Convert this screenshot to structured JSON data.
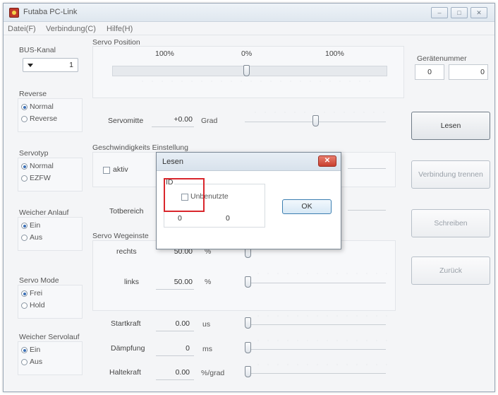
{
  "window": {
    "title": "Futaba PC-Link",
    "controls": [
      "–",
      "□",
      "✕"
    ]
  },
  "menu": {
    "file": "Datei(F)",
    "connection": "Verbindung(C)",
    "help": "Hilfe(H)"
  },
  "bus": {
    "label": "BUS-Kanal",
    "value": "1"
  },
  "reverse": {
    "label": "Reverse",
    "options": [
      "Normal",
      "Reverse"
    ],
    "selected": "Normal"
  },
  "servotype": {
    "label": "Servotyp",
    "options": [
      "Normal",
      "EZFW"
    ],
    "selected": "Normal"
  },
  "soft_start": {
    "label": "Weicher Anlauf",
    "options": [
      "Ein",
      "Aus"
    ],
    "selected": "Ein"
  },
  "servo_mode": {
    "label": "Servo Mode",
    "options": [
      "Frei",
      "Hold"
    ],
    "selected": "Frei"
  },
  "soft_run": {
    "label": "Weicher Servolauf",
    "options": [
      "Ein",
      "Aus"
    ],
    "selected": "Ein"
  },
  "position": {
    "label": "Servo Position",
    "left_pct": "100%",
    "center_pct": "0%",
    "right_pct": "100%"
  },
  "neutral": {
    "label": "Servomitte",
    "value": "+0.00",
    "unit": "Grad"
  },
  "speed": {
    "label": "Geschwindigkeits Einstellung",
    "checkbox_label": "aktiv"
  },
  "deadband": {
    "label": "Totbereich"
  },
  "travel": {
    "label": "Servo Wegeinste",
    "right_label": "rechts",
    "right_value": "50.00",
    "right_unit": "%",
    "left_label": "links",
    "left_value": "50.00",
    "left_unit": "%"
  },
  "start_force": {
    "label": "Startkraft",
    "value": "0.00",
    "unit": "us"
  },
  "damping": {
    "label": "Dämpfung",
    "value": "0",
    "unit": "ms"
  },
  "holding": {
    "label": "Haltekraft",
    "value": "0.00",
    "unit": "%/grad"
  },
  "device": {
    "label": "Gerätenummer",
    "values": [
      "0",
      "0"
    ]
  },
  "buttons": {
    "read": "Lesen",
    "disconnect": "Verbindung trennen",
    "write": "Schreiben",
    "back": "Zurück"
  },
  "dialog": {
    "title": "Lesen",
    "id_label": "ID",
    "checkbox_label": "Unbenutzte",
    "values": [
      "0",
      "0"
    ],
    "ok": "OK"
  },
  "colors": {
    "highlight": "#d9262c",
    "close": "#c8402f"
  }
}
